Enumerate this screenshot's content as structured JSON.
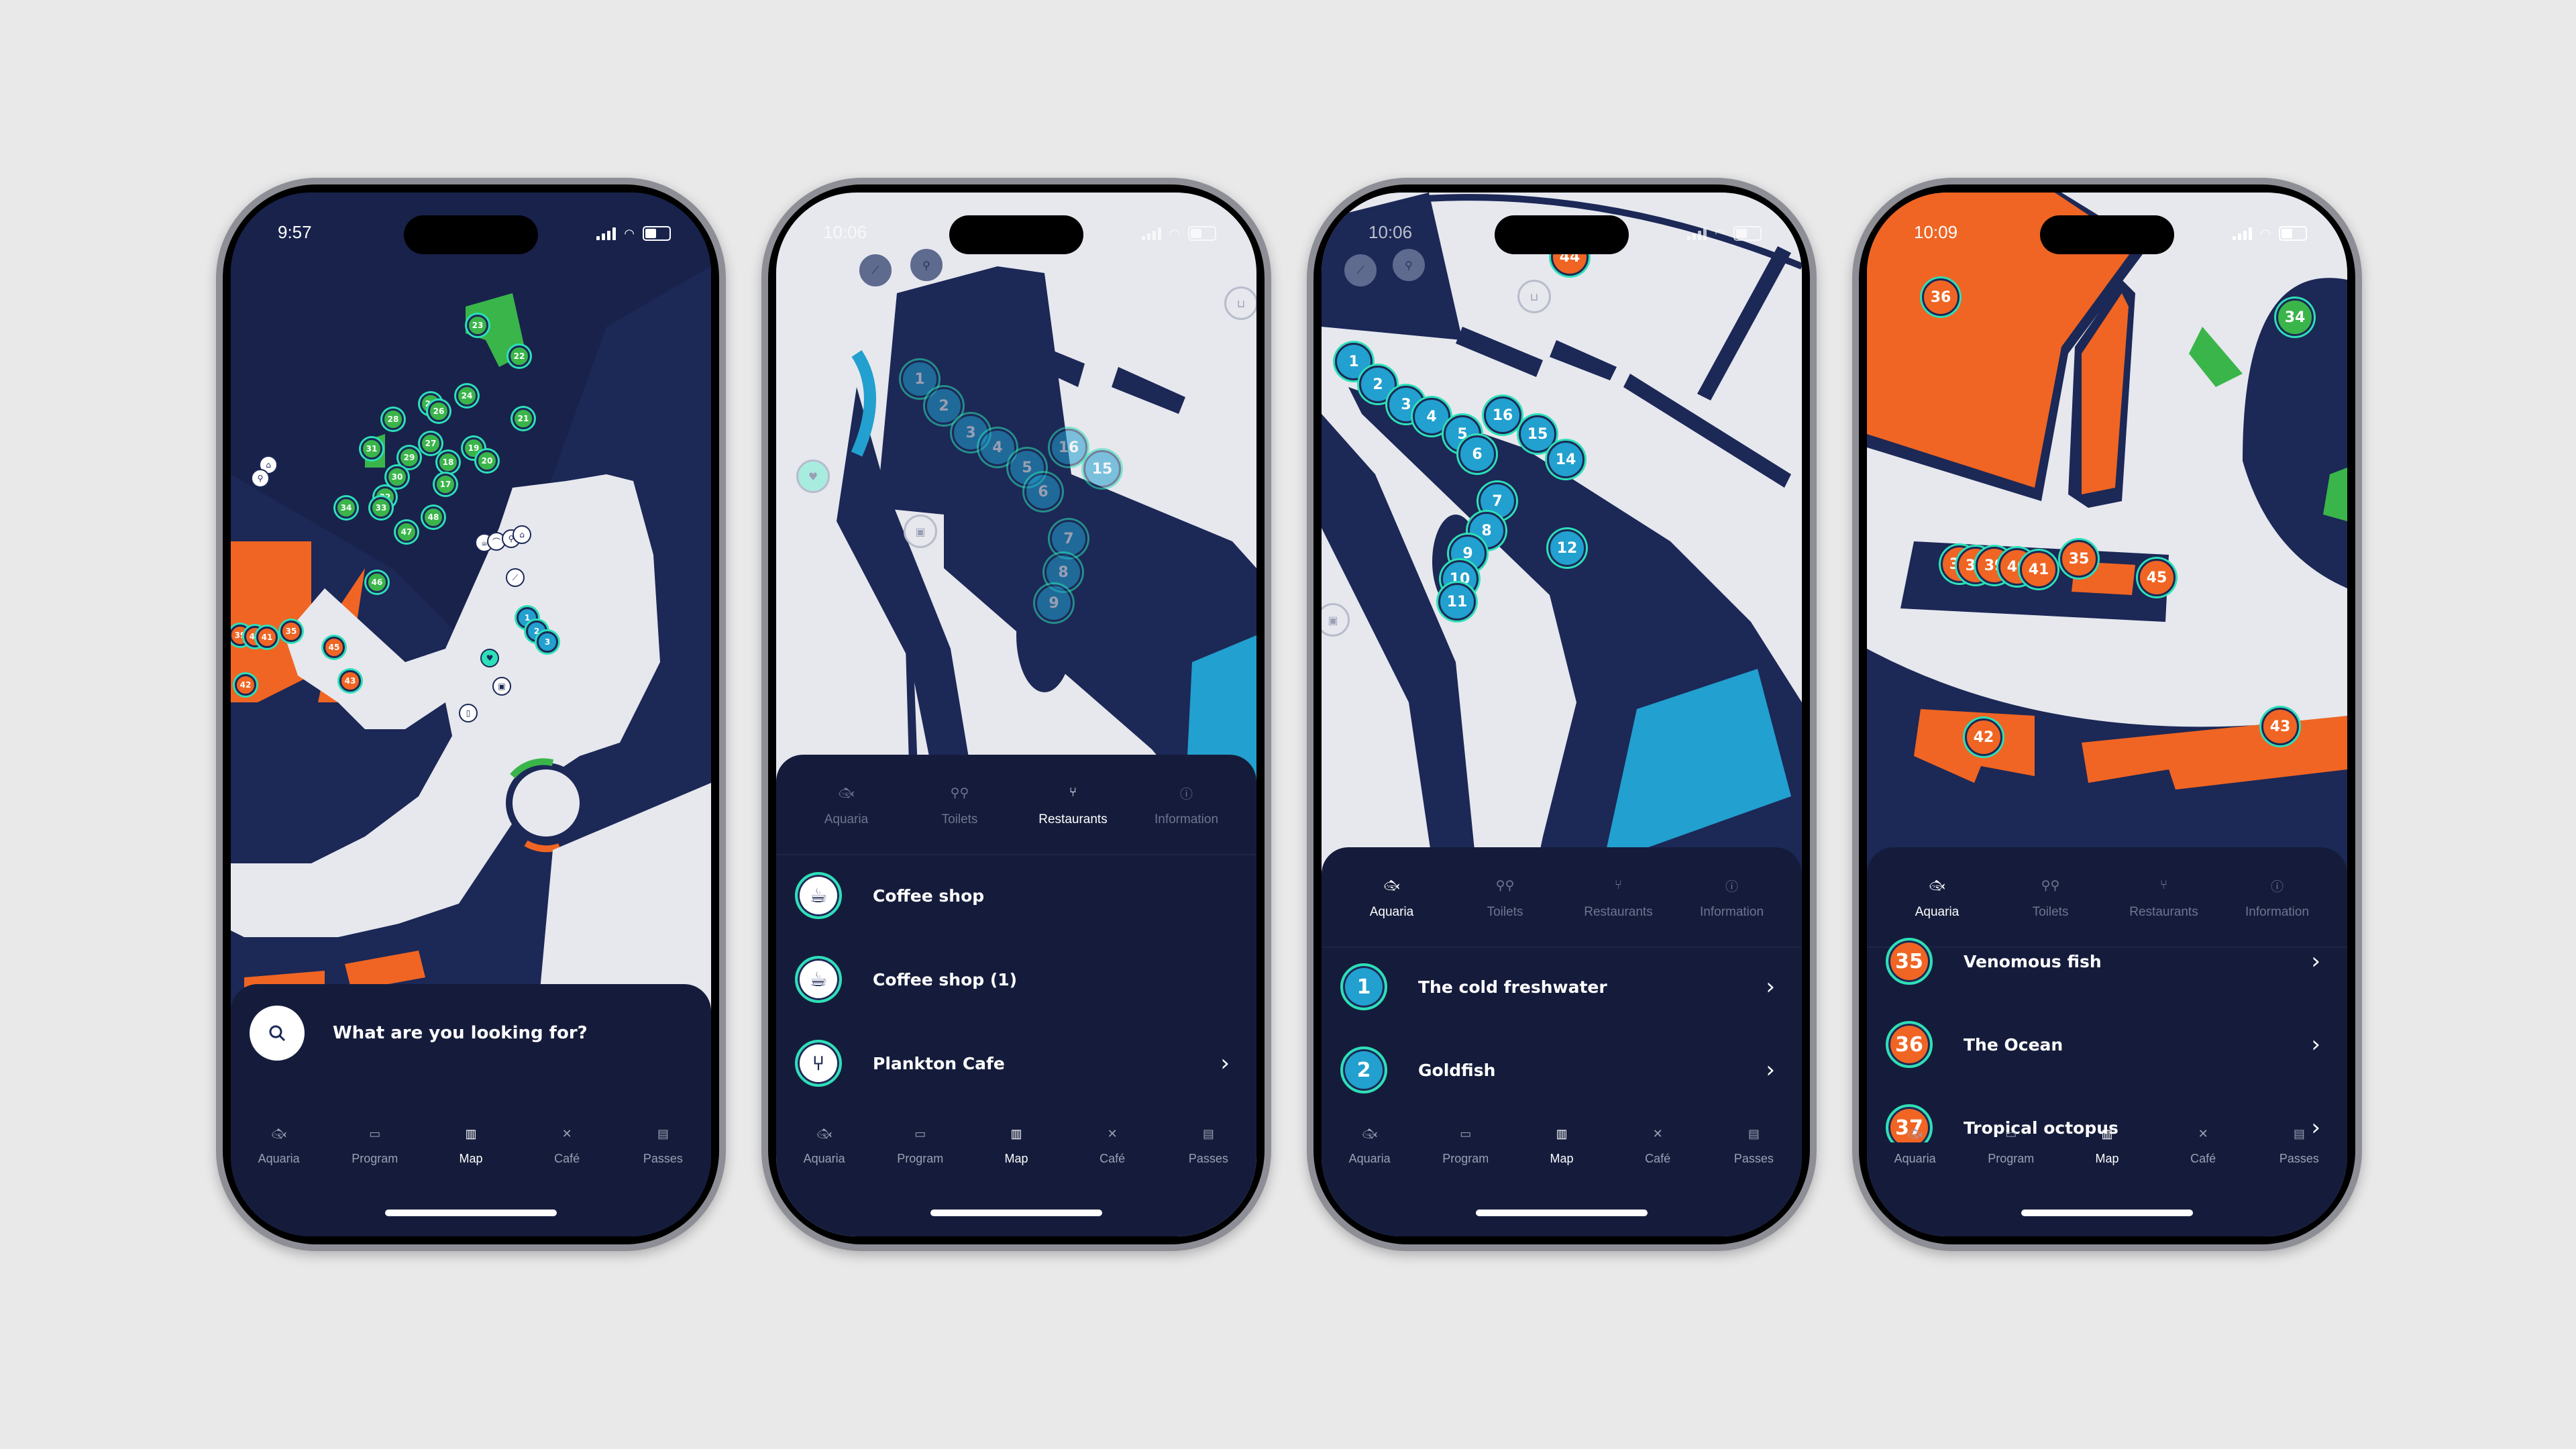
{
  "colors": {
    "navy": "#1c2856",
    "sheet": "#151c3b",
    "path": "#e6e8ee",
    "green": "#3ab54a",
    "blue": "#22a0cf",
    "orange": "#f06523",
    "teal_ring": "#2de0b8"
  },
  "tabbar": [
    {
      "icon": "fish-icon",
      "label": "Aquaria"
    },
    {
      "icon": "calendar-icon",
      "label": "Program"
    },
    {
      "icon": "map-icon",
      "label": "Map"
    },
    {
      "icon": "fork-knife-icon",
      "label": "Café"
    },
    {
      "icon": "id-card-icon",
      "label": "Passes"
    }
  ],
  "categories": [
    {
      "icon": "fish-icon",
      "label": "Aquaria"
    },
    {
      "icon": "toilets-icon",
      "label": "Toilets"
    },
    {
      "icon": "restaurant-icon",
      "label": "Restaurants"
    },
    {
      "icon": "info-icon",
      "label": "Information"
    }
  ],
  "phones": [
    {
      "time": "9:57",
      "search_placeholder": "What are you looking for?",
      "active_tab": "Map",
      "map_pins": {
        "green": [
          "23",
          "22",
          "24",
          "25",
          "26",
          "21",
          "28",
          "27",
          "19",
          "20",
          "31",
          "29",
          "18",
          "30",
          "17",
          "32",
          "33",
          "34",
          "48",
          "47",
          "46"
        ],
        "orange": [
          "39",
          "40",
          "41",
          "35",
          "45",
          "42",
          "43"
        ],
        "blue": [
          "1",
          "2",
          "3"
        ]
      }
    },
    {
      "time": "10:06",
      "active_category": "Restaurants",
      "active_tab": "Map",
      "map_pins": {
        "blue": [
          "1",
          "2",
          "3",
          "4",
          "5",
          "6",
          "16",
          "15",
          "7",
          "8",
          "9"
        ]
      },
      "list": [
        {
          "icon": "coffee-cup-icon",
          "label": "Coffee shop",
          "chevron": false
        },
        {
          "icon": "coffee-cup-icon",
          "label": "Coffee shop (1)",
          "chevron": false
        },
        {
          "icon": "fork-knife-icon",
          "label": "Plankton Cafe",
          "chevron": true
        }
      ]
    },
    {
      "time": "10:06",
      "active_category": "Aquaria",
      "active_tab": "Map",
      "map_pins": {
        "blue": [
          "1",
          "2",
          "3",
          "4",
          "5",
          "6",
          "16",
          "15",
          "14",
          "7",
          "8",
          "9",
          "10",
          "11",
          "12"
        ],
        "orange": [
          "44"
        ]
      },
      "list": [
        {
          "number": "1",
          "label": "The cold freshwater",
          "chevron": true
        },
        {
          "number": "2",
          "label": "Goldfish",
          "chevron": true
        }
      ]
    },
    {
      "time": "10:09",
      "active_category": "Aquaria",
      "active_tab": "Map",
      "map_pins": {
        "orange": [
          "36",
          "37",
          "38",
          "39",
          "40",
          "41",
          "35",
          "45",
          "42",
          "43"
        ],
        "green": [
          "34"
        ]
      },
      "list": [
        {
          "number": "35",
          "label": "Venomous fish",
          "chevron": true
        },
        {
          "number": "36",
          "label": "The Ocean",
          "chevron": true
        },
        {
          "number": "37",
          "label": "Tropical octopus",
          "chevron": true
        }
      ]
    }
  ]
}
